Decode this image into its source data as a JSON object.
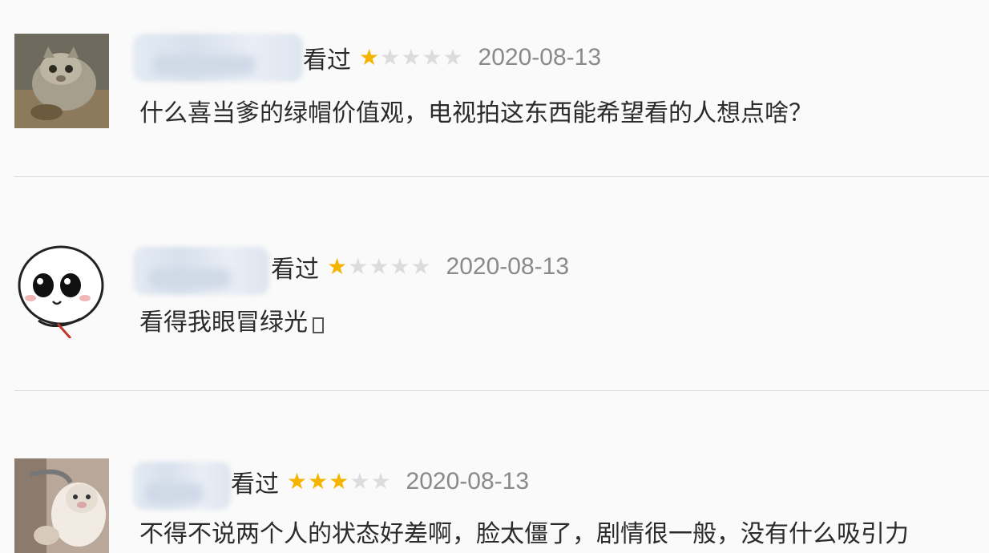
{
  "reviews": [
    {
      "status": "看过",
      "rating": 1,
      "max_rating": 5,
      "date": "2020-08-13",
      "comment": "什么喜当爹的绿帽价值观，电视拍这东西能希望看的人想点啥？",
      "avatar_icon": "cat-photo-avatar"
    },
    {
      "status": "看过",
      "rating": 1,
      "max_rating": 5,
      "date": "2020-08-13",
      "comment": "看得我眼冒绿光",
      "avatar_icon": "cute-face-avatar"
    },
    {
      "status": "看过",
      "rating": 3,
      "max_rating": 5,
      "date": "2020-08-13",
      "comment": "不得不说两个人的状态好差啊，脸太僵了，剧情很一般，没有什么吸引力",
      "avatar_icon": "cat-photo-avatar"
    }
  ],
  "colors": {
    "star_on": "#f4b400",
    "star_off": "#dcdcdc",
    "date": "#8a8a8a",
    "divider": "#d9d9d9"
  }
}
